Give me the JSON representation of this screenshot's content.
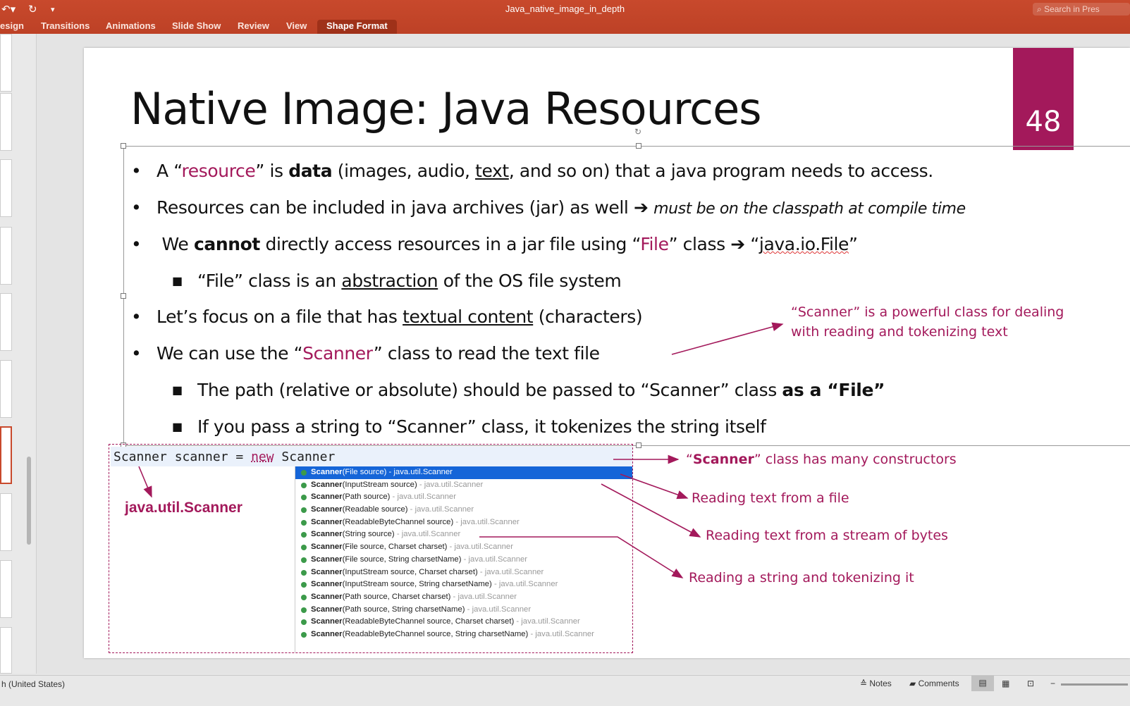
{
  "window": {
    "title": "Java_native_image_in_depth",
    "search_placeholder": "Search in Pres"
  },
  "ribbon": {
    "tabs": [
      "esign",
      "Transitions",
      "Animations",
      "Slide Show",
      "Review",
      "View",
      "Shape Format"
    ],
    "active_tab": "Shape Format"
  },
  "slide": {
    "title": "Native Image: Java Resources",
    "number": "48",
    "bullets": [
      {
        "level": 1,
        "segs": [
          [
            "A “",
            ""
          ],
          [
            "resource",
            "m"
          ],
          [
            "” is ",
            ""
          ],
          [
            "data",
            "b"
          ],
          [
            " (images, audio, ",
            ""
          ],
          [
            "text",
            "u"
          ],
          [
            ", and so on) that a java program needs to access.",
            ""
          ]
        ]
      },
      {
        "level": 1,
        "segs": [
          [
            "Resources can be included in java archives (jar) as well ➔ ",
            ""
          ],
          [
            "must be on the classpath at compile time",
            "i"
          ]
        ]
      },
      {
        "level": 1,
        "segs": [
          [
            " We ",
            ""
          ],
          [
            "cannot",
            "b"
          ],
          [
            " directly access resources in a jar file using “",
            ""
          ],
          [
            "File",
            "m"
          ],
          [
            "” class ➔ “",
            ""
          ],
          [
            "java.io.File",
            "w"
          ],
          [
            "”",
            ""
          ]
        ]
      },
      {
        "level": 2,
        "segs": [
          [
            "“File” class is an ",
            ""
          ],
          [
            "abstraction",
            "u"
          ],
          [
            " of the OS file system",
            ""
          ]
        ]
      },
      {
        "level": 1,
        "segs": [
          [
            "Let’s focus on a file that has ",
            ""
          ],
          [
            "textual content",
            "u"
          ],
          [
            " (characters)",
            ""
          ]
        ]
      },
      {
        "level": 1,
        "segs": [
          [
            "We can use the “",
            ""
          ],
          [
            "Scanner",
            "m"
          ],
          [
            "” class to read the text file",
            ""
          ]
        ]
      },
      {
        "level": 2,
        "segs": [
          [
            "The path (relative or absolute) should be passed to “Scanner” class ",
            ""
          ],
          [
            "as a “File”",
            "b"
          ]
        ]
      },
      {
        "level": 2,
        "segs": [
          [
            "If you pass a string to “Scanner” class, it tokenizes the string itself",
            ""
          ]
        ]
      }
    ],
    "code": {
      "prefix": "Scanner scanner = ",
      "keyword": "new",
      "suffix": " Scanner"
    },
    "package_label": "java.util.Scanner",
    "completions": [
      [
        "Scanner",
        "(File source)",
        "java.util.Scanner"
      ],
      [
        "Scanner",
        "(InputStream source)",
        "java.util.Scanner"
      ],
      [
        "Scanner",
        "(Path source)",
        "java.util.Scanner"
      ],
      [
        "Scanner",
        "(Readable source)",
        "java.util.Scanner"
      ],
      [
        "Scanner",
        "(ReadableByteChannel source)",
        "java.util.Scanner"
      ],
      [
        "Scanner",
        "(String source)",
        "java.util.Scanner"
      ],
      [
        "Scanner",
        "(File source, Charset charset)",
        "java.util.Scanner"
      ],
      [
        "Scanner",
        "(File source, String charsetName)",
        "java.util.Scanner"
      ],
      [
        "Scanner",
        "(InputStream source, Charset charset)",
        "java.util.Scanner"
      ],
      [
        "Scanner",
        "(InputStream source, String charsetName)",
        "java.util.Scanner"
      ],
      [
        "Scanner",
        "(Path source, Charset charset)",
        "java.util.Scanner"
      ],
      [
        "Scanner",
        "(Path source, String charsetName)",
        "java.util.Scanner"
      ],
      [
        "Scanner",
        "(ReadableByteChannel source, Charset charset)",
        "java.util.Scanner"
      ],
      [
        "Scanner",
        "(ReadableByteChannel source, String charsetName)",
        "java.util.Scanner"
      ]
    ],
    "annotations": {
      "scanner_powerful_1": "“Scanner” is a powerful class for dealing",
      "scanner_powerful_2": "with reading and tokenizing text",
      "constructors_q1": "“",
      "constructors_bold": "Scanner",
      "constructors_rest": "” class has many constructors",
      "file": "Reading text from a file",
      "stream": "Reading text from a stream of bytes",
      "string": "Reading a string and tokenizing it"
    }
  },
  "status": {
    "language": "h (United States)",
    "notes": "Notes",
    "comments": "Comments"
  },
  "colors": {
    "ribbon": "#c8492c",
    "accent": "#a3195b",
    "selection": "#1565d8"
  }
}
